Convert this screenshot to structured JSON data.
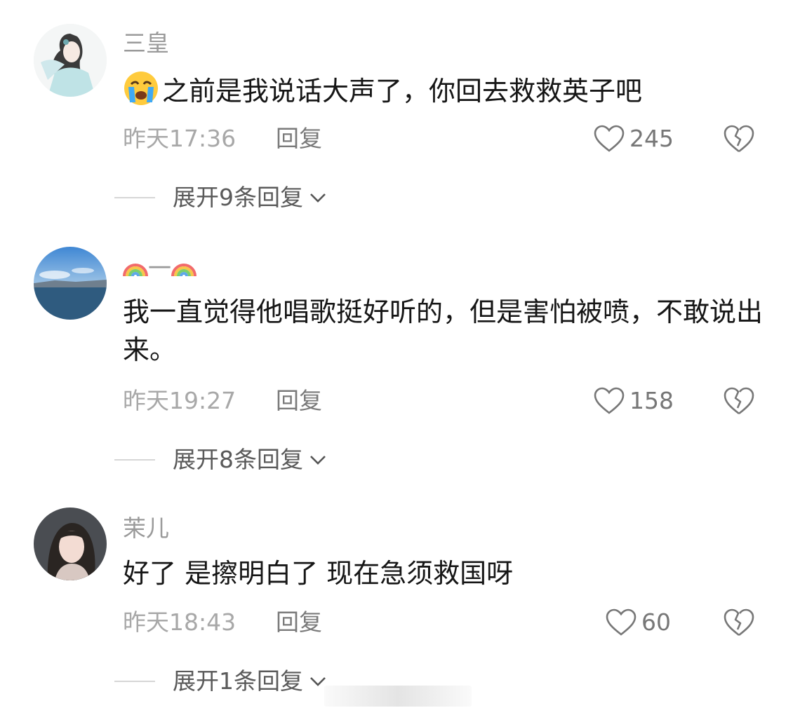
{
  "comments": [
    {
      "username": "三皇",
      "emoji": "loudly-crying-face-emoji",
      "text": "之前是我说话大声了，你回去救救英子吧",
      "time": "昨天17:36",
      "reply_label": "回复",
      "likes": "245",
      "expand_label": "展开9条回复"
    },
    {
      "username": "一",
      "username_prefix_icon": "rainbow-emoji",
      "username_suffix_icon": "rainbow-emoji",
      "text": "我一直觉得他唱歌挺好听的，但是害怕被喷，不敢说出来。",
      "time": "昨天19:27",
      "reply_label": "回复",
      "likes": "158",
      "expand_label": "展开8条回复"
    },
    {
      "username": "茉儿",
      "text": "好了 是擦明白了 现在急须救国呀",
      "time": "昨天18:43",
      "reply_label": "回复",
      "likes": "60",
      "expand_label": "展开1条回复"
    }
  ],
  "colors": {
    "username": "#9a9a9a",
    "text": "#161616",
    "meta": "#a8a8a8",
    "icon_stroke": "#777777"
  }
}
